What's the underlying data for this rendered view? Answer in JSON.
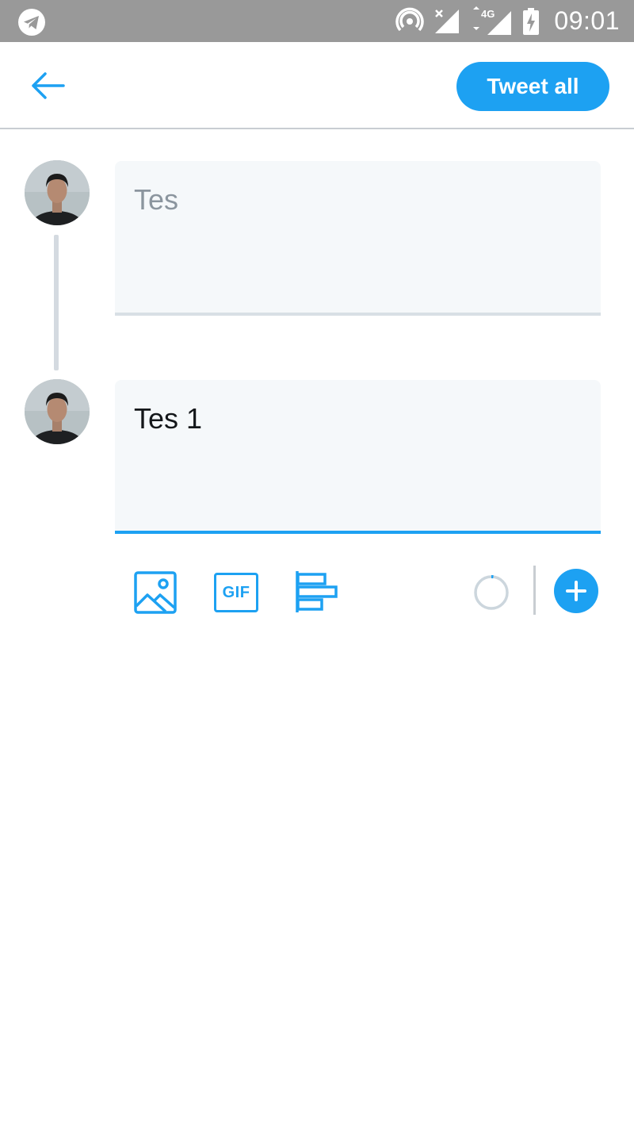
{
  "status_bar": {
    "time": "09:01",
    "left_icon": "telegram-notification-icon",
    "network_type": "4G",
    "icons": [
      "hotspot-icon",
      "signal-x-icon",
      "signal-4g-icon",
      "battery-charging-icon"
    ]
  },
  "header": {
    "back_icon": "back-arrow-icon",
    "tweet_all_label": "Tweet all"
  },
  "thread": {
    "tweets": [
      {
        "text": "Tes",
        "avatar": "user-avatar",
        "state": "placeholder"
      },
      {
        "text": "Tes 1",
        "avatar": "user-avatar",
        "state": "active"
      }
    ]
  },
  "toolbar": {
    "image_icon": "image-icon",
    "gif_label": "GIF",
    "poll_icon": "poll-icon",
    "char_counter_icon": "character-counter-icon",
    "char_counter_progress": 0.02,
    "add_icon": "plus-icon"
  },
  "colors": {
    "accent": "#1da1f2",
    "status_bar": "#999999",
    "compose_bg": "#f5f8fa",
    "divider": "#c8cdd2"
  }
}
